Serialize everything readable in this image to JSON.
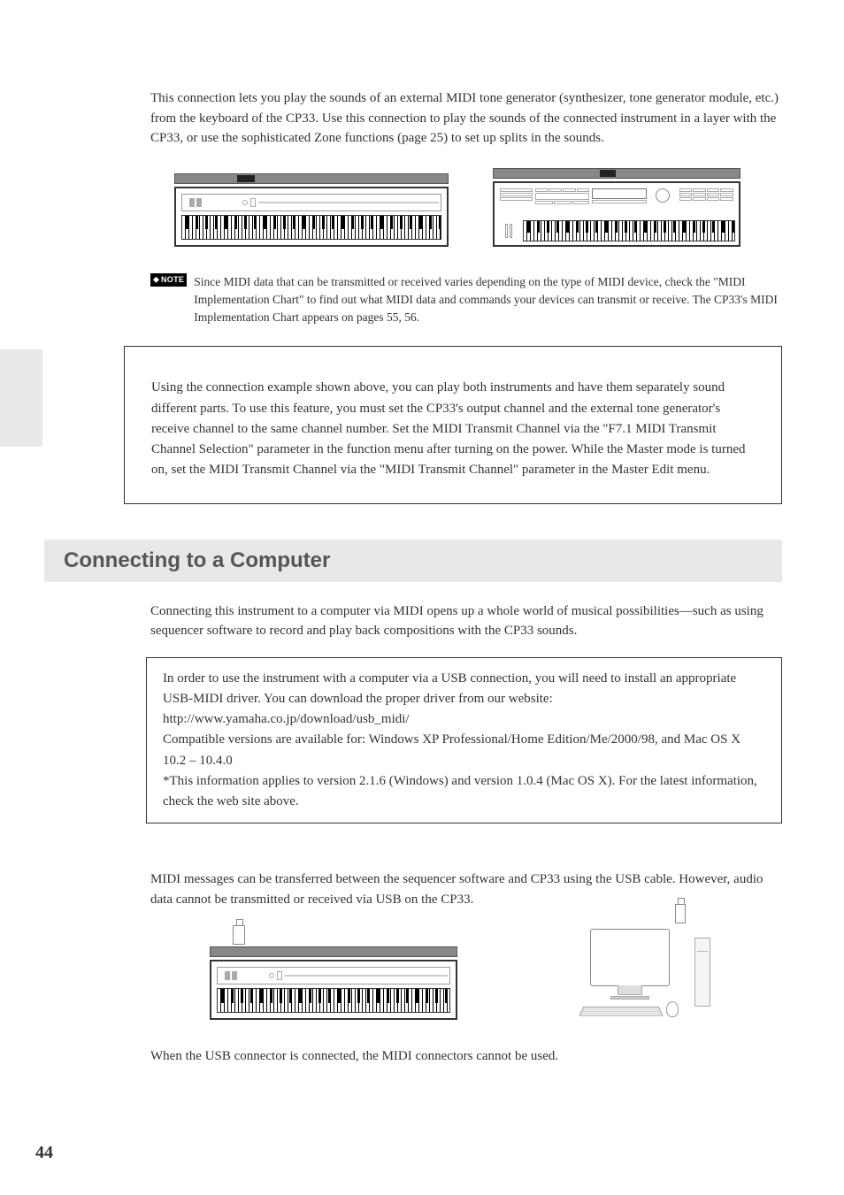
{
  "intro": "This connection lets you play the sounds of an external MIDI tone generator (synthesizer, tone generator module, etc.) from the keyboard of the CP33. Use this connection to play the sounds of the connected instrument in a layer with the CP33, or use the sophisticated Zone functions (page 25) to set up splits in the sounds.",
  "note_badge": "NOTE",
  "note_text": "Since MIDI data that can be transmitted or received varies depending on the type of MIDI device, check the \"MIDI Implementation Chart\" to find out what MIDI data and commands your devices can transmit or receive. The CP33's MIDI Implementation Chart appears on pages 55, 56.",
  "box_text": "Using the connection example shown above, you can play both instruments and have them separately sound different parts. To use this feature, you must set the CP33's output channel and the external tone generator's receive channel to the same channel number. Set the MIDI Transmit Channel via the \"F7.1 MIDI Transmit Channel Selection\" parameter in the function menu after turning on the power. While the Master mode is turned on, set the MIDI Transmit Channel via the \"MIDI Transmit Channel\" parameter in the Master Edit menu.",
  "section_title": "Connecting to a Computer",
  "comp_intro": "Connecting this instrument to a computer via MIDI opens up a whole world of musical possibilities—such as using sequencer software to record and play back compositions with the CP33 sounds.",
  "driver_line1": "In order to use the instrument with a computer via a USB connection, you will need to install an appropriate USB-MIDI driver. You can download the proper driver from our website:",
  "driver_url": "http://www.yamaha.co.jp/download/usb_midi/",
  "driver_compat": "Compatible versions are available for: Windows XP Professional/Home Edition/Me/2000/98, and Mac OS X 10.2 – 10.4.0",
  "driver_note": "*This information applies to version 2.1.6 (Windows) and version 1.0.4 (Mac OS X). For the latest information, check the web site above.",
  "usb_para": "MIDI messages can be transferred between the sequencer software and CP33 using the USB cable. However, audio data cannot be transmitted or received via USB on the CP33.",
  "usb_note": "When the USB connector is connected, the MIDI connectors cannot be used.",
  "page_number": "44"
}
